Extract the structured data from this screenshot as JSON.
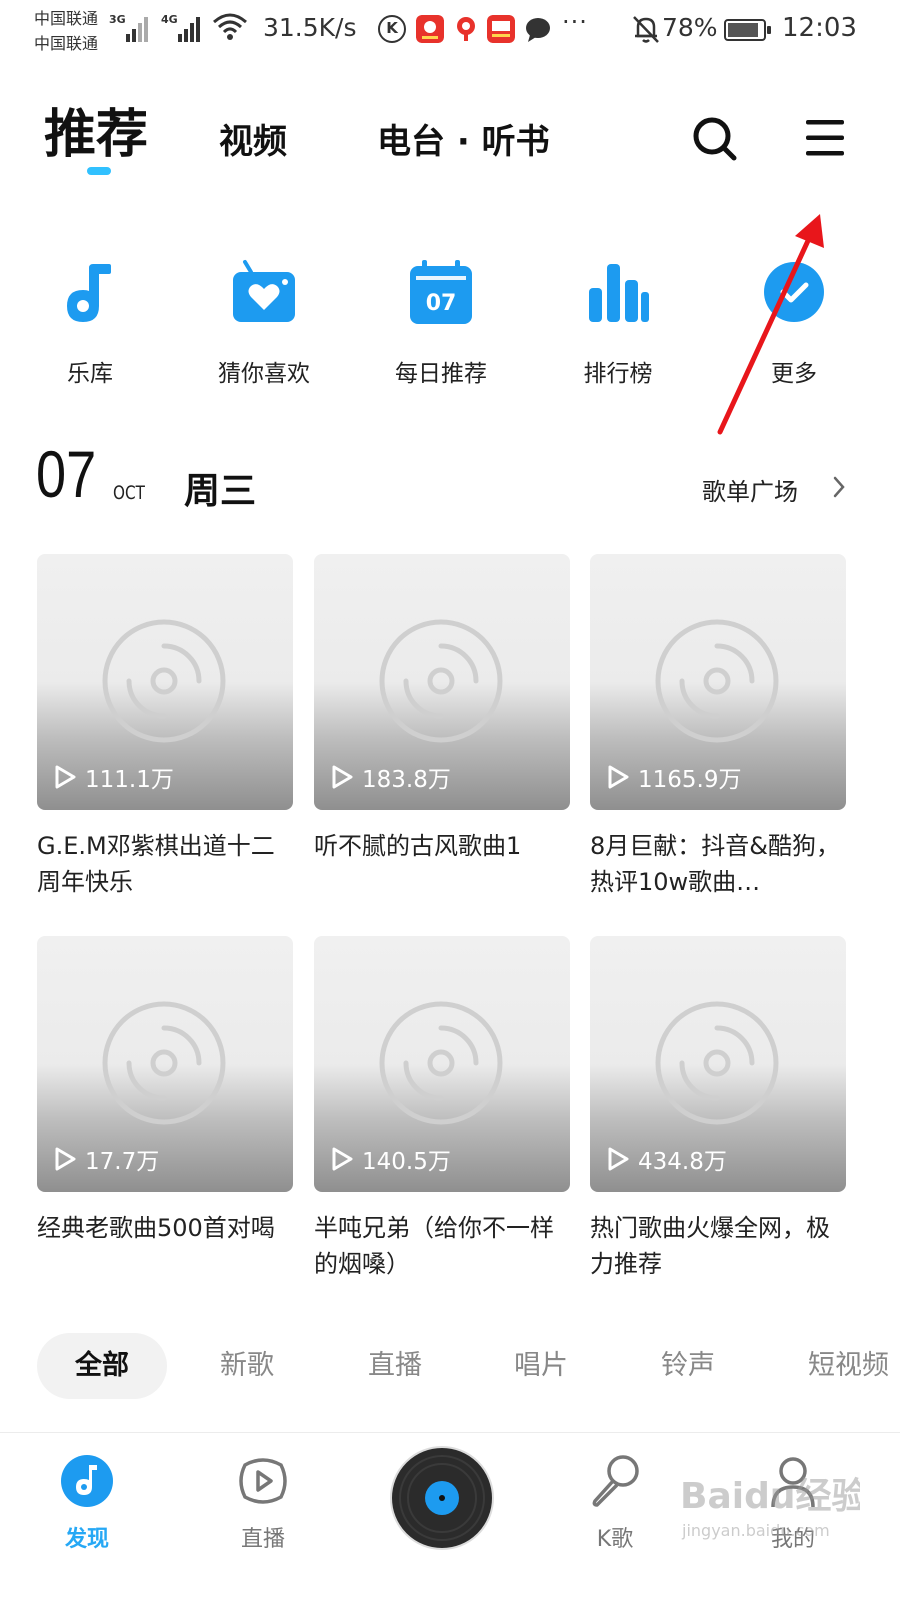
{
  "status_bar": {
    "carrier_top": "中国联通",
    "carrier_bottom": "中国联通",
    "network_1": "3G",
    "network_2": "4G",
    "speed": "31.5K/s",
    "battery": "78%",
    "battery_level": 0.78,
    "time": "12:03",
    "icons": [
      "signal-icon",
      "wifi-icon",
      "k-app-icon",
      "app-notification-icon",
      "location-app-icon",
      "sale-app-icon",
      "message-icon",
      "mute-icon",
      "battery-icon"
    ]
  },
  "header": {
    "tabs": [
      {
        "label": "推荐",
        "active": true
      },
      {
        "label": "视频",
        "active": false
      },
      {
        "label": "电台 · 听书",
        "active": false
      }
    ],
    "accent": "#31c1ff"
  },
  "quick_entries": [
    {
      "label": "乐库",
      "icon": "music-note-icon"
    },
    {
      "label": "猜你喜欢",
      "icon": "heart-radio-icon"
    },
    {
      "label": "每日推荐",
      "icon": "calendar-icon",
      "icon_text": "07"
    },
    {
      "label": "排行榜",
      "icon": "bar-chart-icon"
    },
    {
      "label": "更多",
      "icon": "check-circle-icon"
    }
  ],
  "date": {
    "day": "07",
    "month": "OCT",
    "weekday": "周三",
    "link": "歌单广场"
  },
  "playlists": [
    {
      "plays": "111.1万",
      "title": "G.E.M邓紫棋出道十二周年快乐"
    },
    {
      "plays": "183.8万",
      "title": "听不腻的古风歌曲1"
    },
    {
      "plays": "1165.9万",
      "title": "8月巨献：抖音&酷狗，热评10w歌曲…"
    },
    {
      "plays": "17.7万",
      "title": "经典老歌曲500首对喝"
    },
    {
      "plays": "140.5万",
      "title": "半吨兄弟（给你不一样的烟嗓）"
    },
    {
      "plays": "434.8万",
      "title": "热门歌曲火爆全网，极力推荐"
    }
  ],
  "chips": [
    {
      "label": "全部",
      "active": true
    },
    {
      "label": "新歌",
      "active": false
    },
    {
      "label": "直播",
      "active": false
    },
    {
      "label": "唱片",
      "active": false
    },
    {
      "label": "铃声",
      "active": false
    },
    {
      "label": "短视频",
      "active": false
    }
  ],
  "bottom_nav": [
    {
      "label": "发现",
      "icon": "discover-icon",
      "active": true
    },
    {
      "label": "直播",
      "icon": "live-play-icon",
      "active": false
    },
    {
      "label": "",
      "icon": "vinyl-player-icon",
      "active": false
    },
    {
      "label": "K歌",
      "icon": "microphone-icon",
      "active": false
    },
    {
      "label": "我的",
      "icon": "profile-icon",
      "active": false
    }
  ],
  "watermark": {
    "text": "Baidu经验",
    "sub": "jingyan.baidu.com"
  }
}
